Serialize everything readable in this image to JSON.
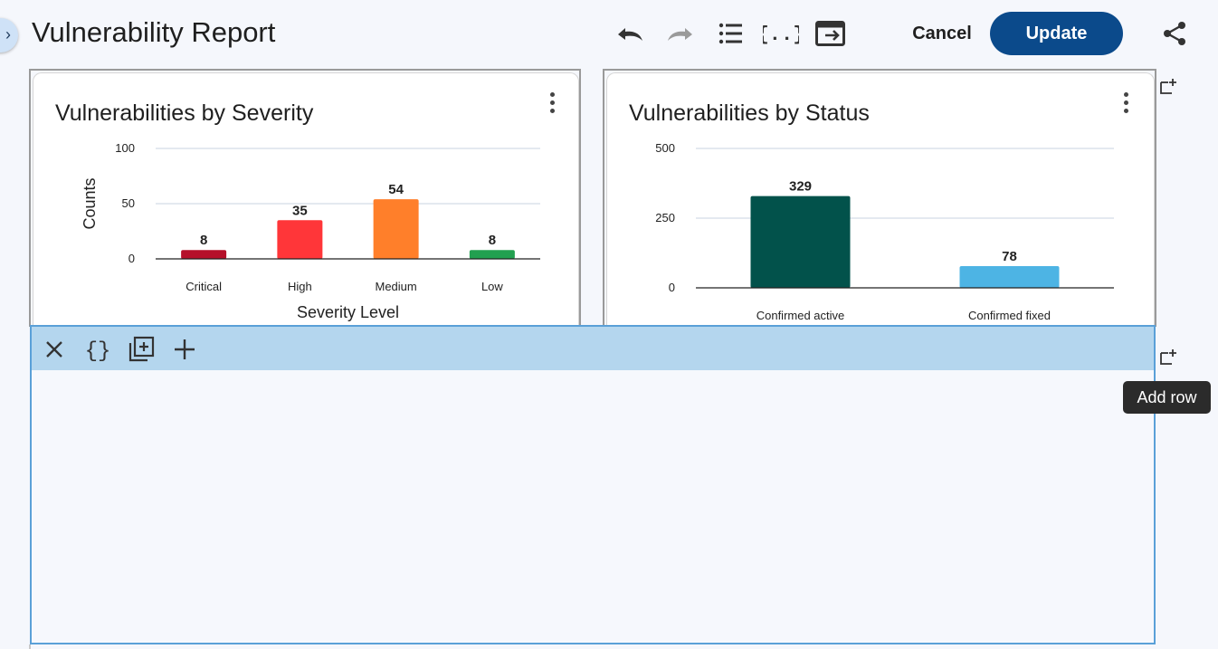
{
  "header": {
    "title": "Vulnerability Report",
    "cancel_label": "Cancel",
    "update_label": "Update",
    "icons": [
      "undo-icon",
      "redo-icon",
      "list-icon",
      "json-braces-icon",
      "export-icon",
      "share-icon"
    ]
  },
  "colors": {
    "primary": "#0b4a8b",
    "selection_border": "#5aa0d8",
    "selection_toolbar": "#b4d6ee"
  },
  "panels": [
    {
      "title": "Vulnerabilities by Severity",
      "chart_data": {
        "type": "bar",
        "title": "Vulnerabilities by Severity",
        "categories": [
          "Critical",
          "High",
          "Medium",
          "Low"
        ],
        "values": [
          8,
          35,
          54,
          8
        ],
        "colors": [
          "#b5102a",
          "#ff3639",
          "#ff7f2a",
          "#22a050"
        ],
        "xlabel": "Severity Level",
        "ylabel": "Counts",
        "ylim": [
          0,
          100
        ],
        "yticks": [
          0,
          50,
          100
        ],
        "grid": true,
        "legend": "none"
      }
    },
    {
      "title": "Vulnerabilities by Status",
      "chart_data": {
        "type": "bar",
        "title": "Vulnerabilities by Status",
        "categories": [
          "Confirmed active",
          "Confirmed fixed"
        ],
        "values": [
          329,
          78
        ],
        "colors": [
          "#02524b",
          "#4db4e4"
        ],
        "xlabel": "",
        "ylabel": "",
        "ylim": [
          0,
          500
        ],
        "yticks": [
          0,
          250,
          500
        ],
        "grid": true,
        "legend": "none"
      }
    }
  ],
  "row_toolbar": {
    "icons": [
      "close-icon",
      "json-braces-icon",
      "duplicate-icon",
      "add-icon"
    ]
  },
  "tooltip": "Add row"
}
